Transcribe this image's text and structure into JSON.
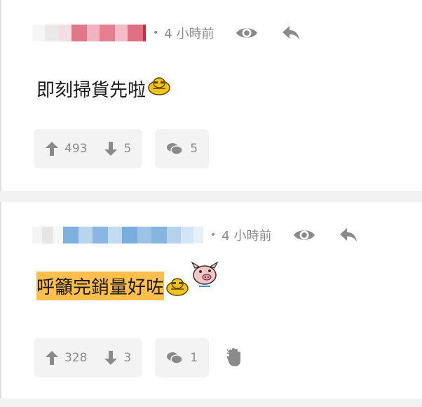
{
  "posts": [
    {
      "time": "4 小時前",
      "content": "即刻掃貨先啦",
      "upvotes": "493",
      "downvotes": "5",
      "replies": "5"
    },
    {
      "time": "4 小時前",
      "content": "呼籲完銷量好咗",
      "upvotes": "328",
      "downvotes": "3",
      "replies": "1"
    }
  ],
  "icons": {
    "view": "eye-icon",
    "reply": "reply-arrow-icon",
    "upvote": "arrow-up-icon",
    "downvote": "arrow-down-icon",
    "comment": "chat-bubbles-icon",
    "hand": "hand-icon",
    "emoji_duck": "duck-emoji-icon",
    "emoji_pig": "pig-emoji-icon"
  },
  "colors": {
    "highlight": "#ffbf4d",
    "meta": "#8a8a8a",
    "text": "#1a1a1a"
  }
}
